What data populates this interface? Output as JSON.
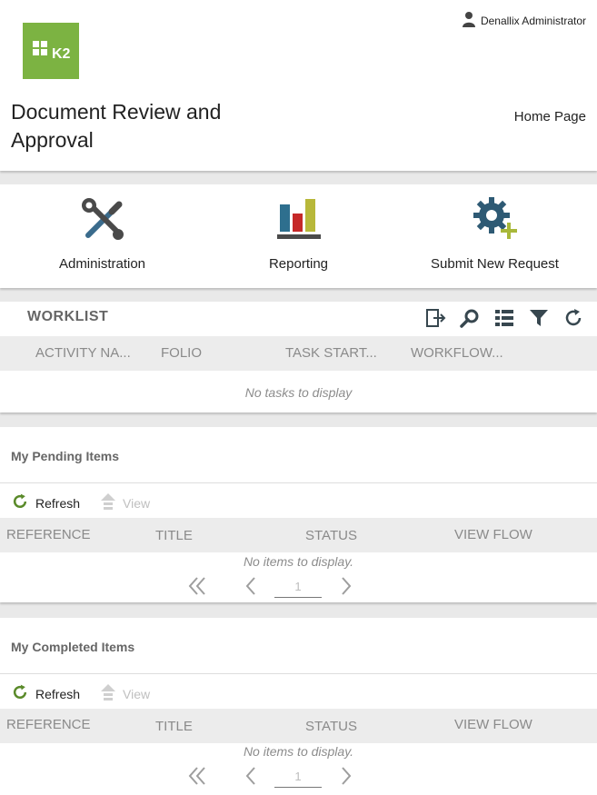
{
  "header": {
    "logo_text": "K2",
    "user_name": "Denallix Administrator",
    "title": "Document Review and Approval",
    "home_link": "Home Page"
  },
  "tiles": [
    {
      "label": "Administration",
      "icon": "tools-icon"
    },
    {
      "label": "Reporting",
      "icon": "bar-chart-icon"
    },
    {
      "label": "Submit New Request",
      "icon": "gear-plus-icon"
    }
  ],
  "worklist": {
    "title": "WORKLIST",
    "tools": [
      "export-icon",
      "search-icon",
      "list-view-icon",
      "filter-icon",
      "refresh-icon"
    ],
    "columns": [
      "ACTIVITY NA...",
      "FOLIO",
      "TASK START...",
      "WORKFLOW..."
    ],
    "empty_text": "No tasks to display"
  },
  "pending": {
    "title": "My Pending Items",
    "refresh_label": "Refresh",
    "view_label": "View",
    "columns": [
      "REFERENCE",
      "TITLE",
      "STATUS",
      "VIEW FLOW"
    ],
    "empty_text": "No items to display.",
    "page": "1"
  },
  "completed": {
    "title": "My Completed Items",
    "refresh_label": "Refresh",
    "view_label": "View",
    "columns": [
      "REFERENCE",
      "TITLE",
      "STATUS",
      "VIEW FLOW"
    ],
    "empty_text": "No items to display.",
    "page": "1"
  },
  "colors": {
    "logo_green": "#7cb342",
    "icon_dark": "#37474f",
    "refresh_green": "#5a8a2a"
  }
}
